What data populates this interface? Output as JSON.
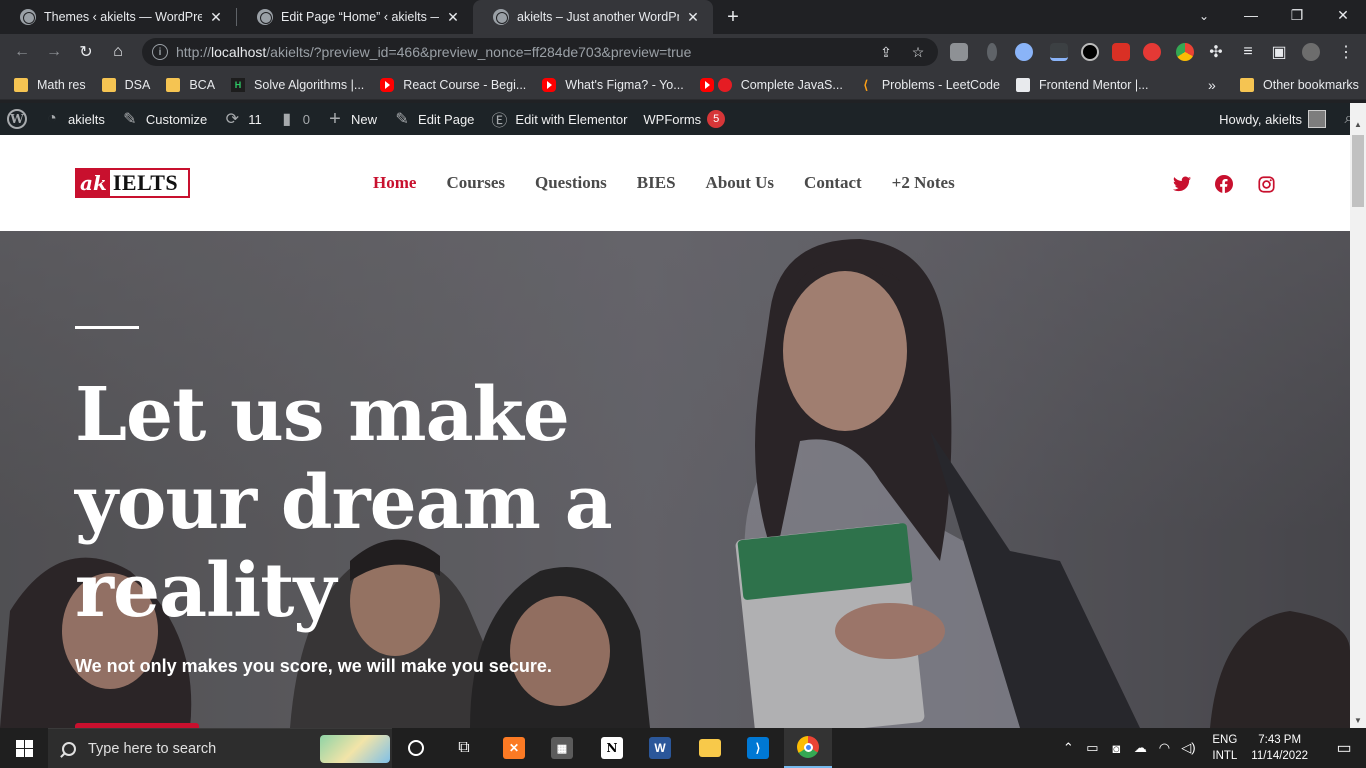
{
  "browser": {
    "tabs": [
      {
        "title": "Themes ‹ akielts — WordPress",
        "active": false
      },
      {
        "title": "Edit Page “Home” ‹ akielts — Wo",
        "active": false
      },
      {
        "title": "akielts – Just another WordPress",
        "active": true
      }
    ],
    "url_prefix": "http://",
    "url_host": "localhost",
    "url_rest": "/akielts/?preview_id=466&preview_nonce=ff284de703&preview=true",
    "bookmarks": [
      {
        "label": "Math res",
        "icon": "folder-icon"
      },
      {
        "label": "DSA",
        "icon": "folder-icon"
      },
      {
        "label": "BCA",
        "icon": "folder-icon"
      },
      {
        "label": "Solve Algorithms |...",
        "icon": "hackerrank-icon"
      },
      {
        "label": "React Course - Begi...",
        "icon": "youtube-icon"
      },
      {
        "label": "What's Figma? - Yo...",
        "icon": "youtube-icon"
      },
      {
        "label": "Complete JavaS...",
        "icon": "youtube-icon"
      },
      {
        "label": "Problems - LeetCode",
        "icon": "leetcode-icon"
      },
      {
        "label": "Frontend Mentor |...",
        "icon": "frontendmentor-icon"
      }
    ],
    "bookmarks_more": "»",
    "other_bookmarks": "Other bookmarks"
  },
  "adminbar": {
    "site_name": "akielts",
    "customize": "Customize",
    "updates_count": "11",
    "comments_count": "0",
    "new_label": "New",
    "edit_page": "Edit Page",
    "elementor": "Edit with Elementor",
    "wpforms": "WPForms",
    "wpforms_badge": "5",
    "howdy": "Howdy, akielts"
  },
  "site": {
    "logo_ak": "ak",
    "logo_text": "IELTS",
    "menu": [
      {
        "label": "Home",
        "current": true
      },
      {
        "label": "Courses",
        "current": false
      },
      {
        "label": "Questions",
        "current": false
      },
      {
        "label": "BIES",
        "current": false
      },
      {
        "label": "About Us",
        "current": false
      },
      {
        "label": "Contact",
        "current": false
      },
      {
        "label": "+2 Notes",
        "current": false
      }
    ],
    "accent_color": "#c8102e"
  },
  "hero": {
    "title_line1": "Let us make",
    "title_line2": "your dream a",
    "title_line3": "reality",
    "subtitle": "We not only makes you score, we will make you secure."
  },
  "taskbar": {
    "search_placeholder": "Type here to search",
    "lang_top": "ENG",
    "lang_bottom": "INTL",
    "time": "7:43 PM",
    "date": "11/14/2022"
  }
}
